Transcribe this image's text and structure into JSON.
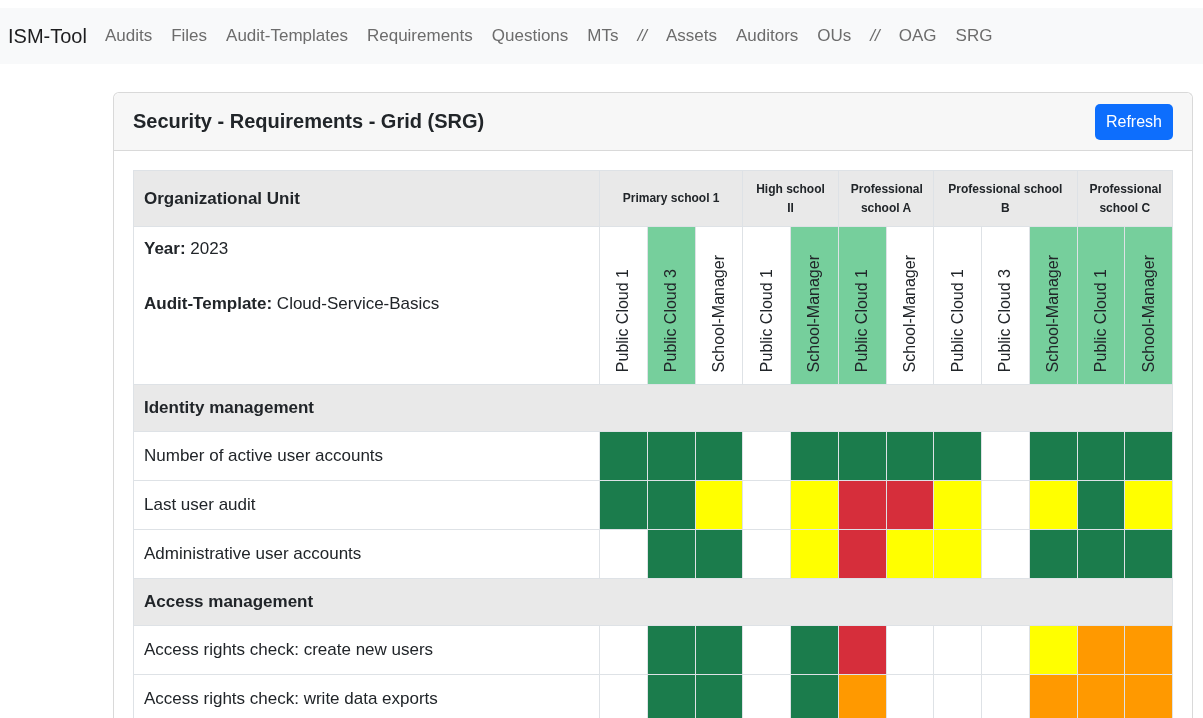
{
  "navbar": {
    "brand": "ISM-Tool",
    "links": [
      {
        "label": "Audits",
        "kind": "link"
      },
      {
        "label": "Files",
        "kind": "link"
      },
      {
        "label": "Audit-Templates",
        "kind": "link"
      },
      {
        "label": "Requirements",
        "kind": "link"
      },
      {
        "label": "Questions",
        "kind": "link"
      },
      {
        "label": "MTs",
        "kind": "link"
      },
      {
        "label": "//",
        "kind": "separator"
      },
      {
        "label": "Assets",
        "kind": "link"
      },
      {
        "label": "Auditors",
        "kind": "link"
      },
      {
        "label": "OUs",
        "kind": "link"
      },
      {
        "label": "//",
        "kind": "separator"
      },
      {
        "label": "OAG",
        "kind": "link"
      },
      {
        "label": "SRG",
        "kind": "link"
      }
    ]
  },
  "card": {
    "title": "Security - Requirements - Grid (SRG)",
    "button": "Refresh"
  },
  "grid": {
    "corner_label": "Organizational Unit",
    "info": [
      {
        "label": "Year:",
        "value": "2023"
      },
      {
        "label": "Audit-Template:",
        "value": "Cloud-Service-Basics"
      }
    ],
    "groups": [
      {
        "name": "Primary school 1",
        "columns": [
          {
            "name": "Public Cloud 1",
            "highlighted": false
          },
          {
            "name": "Public Cloud 3",
            "highlighted": true
          },
          {
            "name": "School-Manager",
            "highlighted": false
          }
        ]
      },
      {
        "name": "High school II",
        "columns": [
          {
            "name": "Public Cloud 1",
            "highlighted": false
          },
          {
            "name": "School-Manager",
            "highlighted": true
          }
        ]
      },
      {
        "name": "Professional school A",
        "columns": [
          {
            "name": "Public Cloud 1",
            "highlighted": true
          },
          {
            "name": "School-Manager",
            "highlighted": false
          }
        ]
      },
      {
        "name": "Professional school B",
        "columns": [
          {
            "name": "Public Cloud 1",
            "highlighted": false
          },
          {
            "name": "Public Cloud 3",
            "highlighted": false
          },
          {
            "name": "School-Manager",
            "highlighted": true
          }
        ]
      },
      {
        "name": "Professional school C",
        "columns": [
          {
            "name": "Public Cloud 1",
            "highlighted": true
          },
          {
            "name": "School-Manager",
            "highlighted": true
          }
        ]
      }
    ],
    "rows": [
      {
        "kind": "section",
        "label": "Identity management"
      },
      {
        "kind": "requirement",
        "label": "Number of active user accounts",
        "cells": [
          {
            "kind": "rated",
            "color": "#1b7c4c"
          },
          {
            "kind": "rated",
            "color": "#1b7c4c"
          },
          {
            "kind": "rated",
            "color": "#1b7c4c"
          },
          {
            "kind": "empty"
          },
          {
            "kind": "rated",
            "color": "#1b7c4c"
          },
          {
            "kind": "rated",
            "color": "#1b7c4c"
          },
          {
            "kind": "rated",
            "color": "#1b7c4c"
          },
          {
            "kind": "rated",
            "color": "#1b7c4c"
          },
          {
            "kind": "empty"
          },
          {
            "kind": "rated",
            "color": "#1b7c4c"
          },
          {
            "kind": "rated",
            "color": "#1b7c4c"
          },
          {
            "kind": "rated",
            "color": "#1b7c4c"
          }
        ]
      },
      {
        "kind": "requirement",
        "label": "Last user audit",
        "cells": [
          {
            "kind": "rated",
            "color": "#1b7c4c"
          },
          {
            "kind": "rated",
            "color": "#1b7c4c"
          },
          {
            "kind": "rated",
            "color": "#ffff00"
          },
          {
            "kind": "empty"
          },
          {
            "kind": "rated",
            "color": "#ffff00"
          },
          {
            "kind": "rated",
            "color": "#d62e3b"
          },
          {
            "kind": "rated",
            "color": "#d62e3b"
          },
          {
            "kind": "rated",
            "color": "#ffff00"
          },
          {
            "kind": "empty"
          },
          {
            "kind": "rated",
            "color": "#ffff00"
          },
          {
            "kind": "rated",
            "color": "#1b7c4c"
          },
          {
            "kind": "rated",
            "color": "#ffff00"
          }
        ]
      },
      {
        "kind": "requirement",
        "label": "Administrative user accounts",
        "cells": [
          {
            "kind": "empty"
          },
          {
            "kind": "rated",
            "color": "#1b7c4c"
          },
          {
            "kind": "rated",
            "color": "#1b7c4c"
          },
          {
            "kind": "empty"
          },
          {
            "kind": "rated",
            "color": "#ffff00"
          },
          {
            "kind": "rated",
            "color": "#d62e3b"
          },
          {
            "kind": "rated",
            "color": "#ffff00"
          },
          {
            "kind": "rated",
            "color": "#ffff00"
          },
          {
            "kind": "empty"
          },
          {
            "kind": "rated",
            "color": "#1b7c4c"
          },
          {
            "kind": "rated",
            "color": "#1b7c4c"
          },
          {
            "kind": "rated",
            "color": "#1b7c4c"
          }
        ]
      },
      {
        "kind": "section",
        "label": "Access management"
      },
      {
        "kind": "requirement",
        "label": "Access rights check: create new users",
        "cells": [
          {
            "kind": "empty"
          },
          {
            "kind": "rated",
            "color": "#1b7c4c"
          },
          {
            "kind": "rated",
            "color": "#1b7c4c"
          },
          {
            "kind": "empty"
          },
          {
            "kind": "rated",
            "color": "#1b7c4c"
          },
          {
            "kind": "rated",
            "color": "#d62e3b"
          },
          {
            "kind": "empty"
          },
          {
            "kind": "empty"
          },
          {
            "kind": "empty"
          },
          {
            "kind": "rated",
            "color": "#ffff00"
          },
          {
            "kind": "rated",
            "color": "#ff9900"
          },
          {
            "kind": "rated",
            "color": "#ff9900"
          }
        ]
      },
      {
        "kind": "requirement",
        "label": "Access rights check: write data exports",
        "cells": [
          {
            "kind": "empty"
          },
          {
            "kind": "rated",
            "color": "#1b7c4c"
          },
          {
            "kind": "rated",
            "color": "#1b7c4c"
          },
          {
            "kind": "empty"
          },
          {
            "kind": "rated",
            "color": "#1b7c4c"
          },
          {
            "kind": "rated",
            "color": "#ff9900"
          },
          {
            "kind": "empty"
          },
          {
            "kind": "empty"
          },
          {
            "kind": "empty"
          },
          {
            "kind": "rated",
            "color": "#ff9900"
          },
          {
            "kind": "rated",
            "color": "#ff9900"
          },
          {
            "kind": "rated",
            "color": "#ff9900"
          }
        ]
      }
    ]
  }
}
